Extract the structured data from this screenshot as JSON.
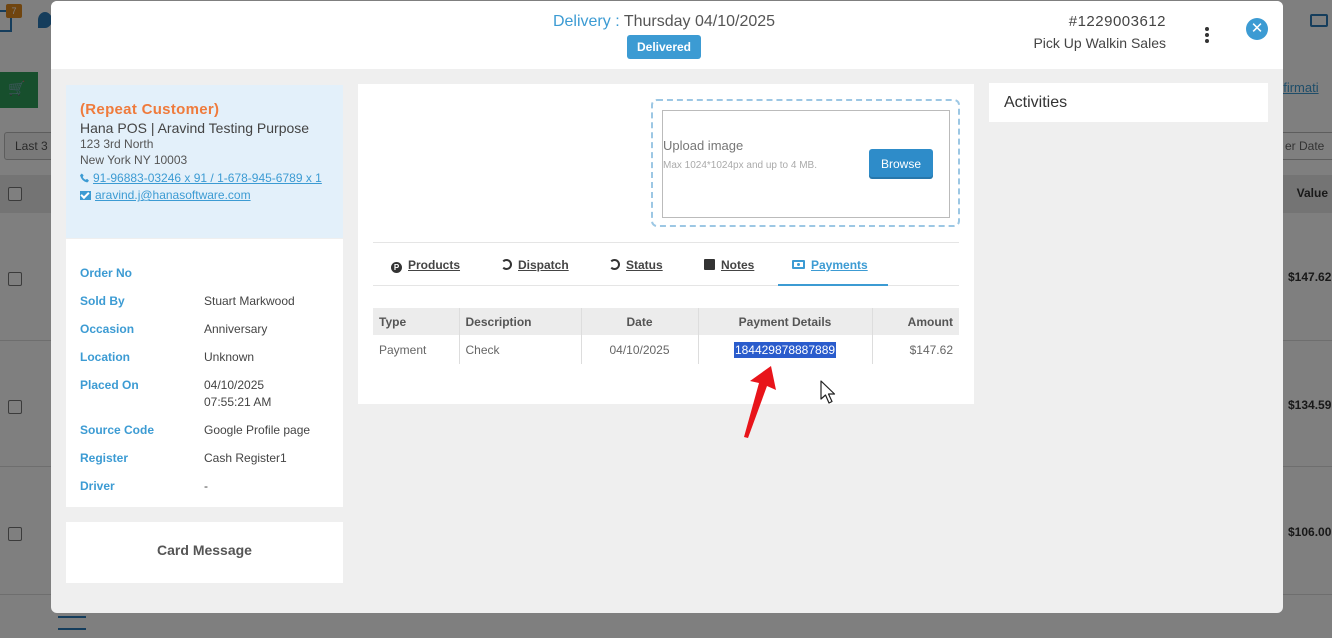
{
  "background": {
    "badge_count": "7",
    "confirm_link": "nfirmati",
    "last_filter": "Last 3",
    "order_date_filter": "er Date",
    "value_header": "Value",
    "row_amounts": [
      "$147.62",
      "$134.59",
      "$106.00"
    ]
  },
  "modal": {
    "header": {
      "delivery_label": "Delivery :",
      "delivery_date": "Thursday 04/10/2025",
      "status_badge": "Delivered",
      "order_number": "#1229003612",
      "order_type": "Pick Up Walkin Sales"
    },
    "customer": {
      "tag": "(Repeat Customer)",
      "name": "Hana POS | Aravind Testing Purpose",
      "address_line1": "123 3rd North",
      "address_line2": "New York NY 10003",
      "phone": "91-96883-03246 x 91 / 1-678-945-6789 x 1",
      "email": "aravind.j@hanasoftware.com"
    },
    "order_info": {
      "order_no_label": "Order No",
      "order_no_value": "",
      "sold_by_label": "Sold By",
      "sold_by_value": "Stuart Markwood",
      "occasion_label": "Occasion",
      "occasion_value": "Anniversary",
      "location_label": "Location",
      "location_value": "Unknown",
      "placed_on_label": "Placed On",
      "placed_on_date": "04/10/2025",
      "placed_on_time": "07:55:21 AM",
      "source_code_label": "Source Code",
      "source_code_value": "Google Profile page",
      "register_label": "Register",
      "register_value": "Cash Register1",
      "driver_label": "Driver",
      "driver_value": "-"
    },
    "card_message_label": "Card Message",
    "upload": {
      "title": "Upload image",
      "hint": "Max 1024*1024px and up to 4 MB.",
      "browse_label": "Browse"
    },
    "tabs": [
      {
        "label": "Products",
        "icon": "product-icon"
      },
      {
        "label": "Dispatch",
        "icon": "history-icon"
      },
      {
        "label": "Status",
        "icon": "history-icon"
      },
      {
        "label": "Notes",
        "icon": "note-icon"
      },
      {
        "label": "Payments",
        "icon": "money-icon",
        "active": true
      }
    ],
    "payments_table": {
      "columns": [
        "Type",
        "Description",
        "Date",
        "Payment Details",
        "Amount"
      ],
      "rows": [
        {
          "type": "Payment",
          "description": "Check",
          "date": "04/10/2025",
          "details": "184429878887889",
          "amount": "$147.62"
        }
      ]
    },
    "activities_title": "Activities"
  },
  "colors": {
    "accent": "#3c9bd3",
    "repeat_customer": "#ef7b3c",
    "annotation_arrow": "#e8141a"
  }
}
